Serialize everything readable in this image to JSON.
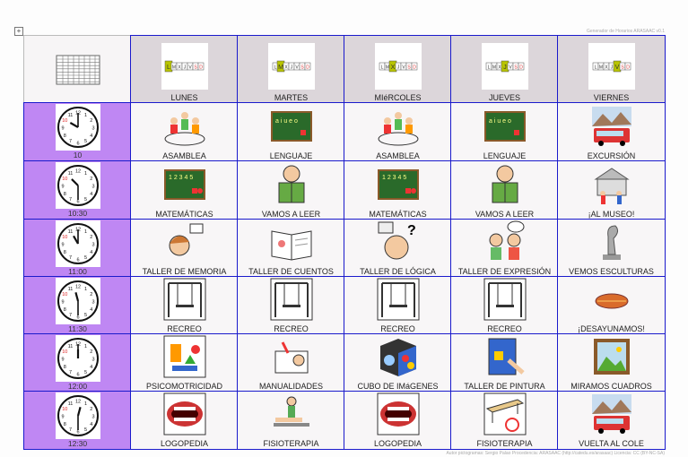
{
  "credits": {
    "top": "Generador de Horarios ARASAAC v0.1",
    "bottom": "Autor pictogramas: Sergio Palao Procedencia: ARASAAC (http://catedu.es/arasaac) Licencia: CC (BY-NC-SA)"
  },
  "corner_icon": "timetable-icon",
  "days": [
    {
      "label": "LUNES",
      "letter": "L"
    },
    {
      "label": "MARTES",
      "letter": "M"
    },
    {
      "label": "MIéRCOLES",
      "letter": "X"
    },
    {
      "label": "JUEVES",
      "letter": "J"
    },
    {
      "label": "VIERNES",
      "letter": "V"
    }
  ],
  "week_letters": [
    "L",
    "M",
    "X",
    "J",
    "V",
    "S",
    "D"
  ],
  "colors": {
    "border": "#1a1acc",
    "time_column": "#bf87f3",
    "header": "#dcd6da",
    "highlight": "#b8c400"
  },
  "rows": [
    {
      "time": "10",
      "hour": 10,
      "minute": 0,
      "activities": [
        {
          "label": "ASAMBLEA",
          "icon": "assembly-icon"
        },
        {
          "label": "LENGUAJE",
          "icon": "chalkboard-letters-icon"
        },
        {
          "label": "ASAMBLEA",
          "icon": "assembly-icon"
        },
        {
          "label": "LENGUAJE",
          "icon": "chalkboard-letters-icon"
        },
        {
          "label": "EXCURSIÓN",
          "icon": "bus-icon"
        }
      ]
    },
    {
      "time": "10:30",
      "hour": 10,
      "minute": 30,
      "activities": [
        {
          "label": "MATEMÁTICAS",
          "icon": "chalkboard-numbers-icon"
        },
        {
          "label": "VAMOS A LEER",
          "icon": "reading-child-icon"
        },
        {
          "label": "MATEMÁTICAS",
          "icon": "chalkboard-numbers-icon"
        },
        {
          "label": "VAMOS A LEER",
          "icon": "reading-child-icon"
        },
        {
          "label": "¡AL MUSEO!",
          "icon": "museum-icon"
        }
      ]
    },
    {
      "time": "11:00",
      "hour": 11,
      "minute": 0,
      "activities": [
        {
          "label": "TALLER DE MEMORIA",
          "icon": "thinking-icon"
        },
        {
          "label": "TALLER DE CUENTOS",
          "icon": "storybook-icon"
        },
        {
          "label": "TALLER DE LÓGICA",
          "icon": "question-head-icon"
        },
        {
          "label": "TALLER DE EXPRESIÓN",
          "icon": "talking-children-icon"
        },
        {
          "label": "VEMOS ESCULTURAS",
          "icon": "sculpture-icon"
        }
      ]
    },
    {
      "time": "11:30",
      "hour": 11,
      "minute": 30,
      "activities": [
        {
          "label": "RECREO",
          "icon": "swing-icon"
        },
        {
          "label": "RECREO",
          "icon": "swing-icon"
        },
        {
          "label": "RECREO",
          "icon": "swing-icon"
        },
        {
          "label": "RECREO",
          "icon": "swing-icon"
        },
        {
          "label": "¡DESAYUNAMOS!",
          "icon": "sandwich-icon"
        }
      ]
    },
    {
      "time": "12:00",
      "hour": 12,
      "minute": 0,
      "activities": [
        {
          "label": "PSICOMOTRICIDAD",
          "icon": "blocks-icon"
        },
        {
          "label": "MANUALIDADES",
          "icon": "crafts-icon"
        },
        {
          "label": "CUBO DE IMáGENES",
          "icon": "image-cube-icon"
        },
        {
          "label": "TALLER DE PINTURA",
          "icon": "painting-icon"
        },
        {
          "label": "MIRAMOS CUADROS",
          "icon": "framed-picture-icon"
        }
      ]
    },
    {
      "time": "12:30",
      "hour": 12,
      "minute": 30,
      "activities": [
        {
          "label": "LOGOPEDIA",
          "icon": "mouth-icon"
        },
        {
          "label": "FISIOTERAPIA",
          "icon": "physiotherapy-icon"
        },
        {
          "label": "LOGOPEDIA",
          "icon": "mouth-icon"
        },
        {
          "label": "FISIOTERAPIA",
          "icon": "bench-ball-icon"
        },
        {
          "label": "VUELTA AL COLE",
          "icon": "bus-icon"
        }
      ]
    }
  ]
}
